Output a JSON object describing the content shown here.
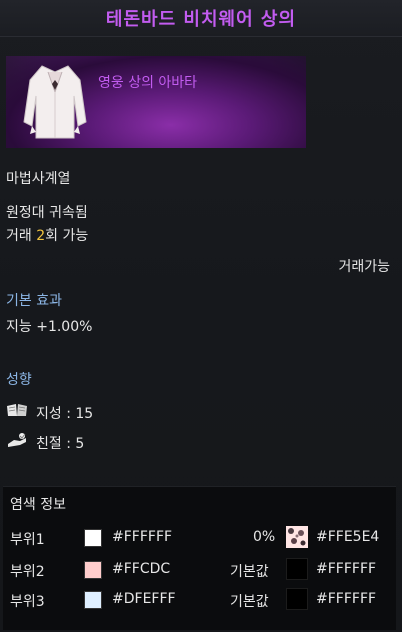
{
  "item": {
    "name": "테돈바드 비치웨어 상의",
    "grade_text": "영웅 상의 아바타",
    "class_restriction": "마법사계열",
    "bound": "원정대 귀속됨",
    "trade_prefix": "거래 ",
    "trade_count": "2",
    "trade_suffix": "회 가능",
    "trade_status": "거래가능"
  },
  "base_effect": {
    "header": "기본 효과",
    "value": "지능 +1.00%"
  },
  "tendency": {
    "header": "성향",
    "stats": [
      {
        "icon": "book-icon",
        "label": "지성 : 15"
      },
      {
        "icon": "handshake-icon",
        "label": "친절 : 5"
      }
    ]
  },
  "dye": {
    "header": "염색 정보",
    "rows": [
      {
        "part": "부위1",
        "color_hex": "#FFFFFF",
        "color": "#FFFFFF",
        "sub_label": "0%",
        "pattern": true,
        "pattern_hex": "#FFE5E4",
        "pattern_color": "#FFE5E4"
      },
      {
        "part": "부위2",
        "color_hex": "#FFCDC",
        "color": "#FFCDCC",
        "sub_label": "기본값",
        "pattern": false,
        "pattern_hex": "#FFFFFF",
        "pattern_color": "#000000"
      },
      {
        "part": "부위3",
        "color_hex": "#DFEFFF",
        "color": "#DFEFFF",
        "sub_label": "기본값",
        "pattern": false,
        "pattern_hex": "#FFFFFF",
        "pattern_color": "#000000"
      }
    ]
  },
  "colors": {
    "title": "#c25cf0",
    "section": "#8cb6e6",
    "highlight": "#f2c540"
  }
}
